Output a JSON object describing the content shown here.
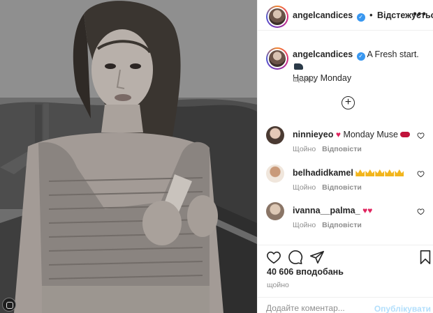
{
  "post": {
    "image_alt": "Black and white portrait of a woman holding a brush"
  },
  "header": {
    "username": "angelcandices",
    "separator": "•",
    "follow_status": "Відстежується",
    "more_label": "•••"
  },
  "caption": {
    "username": "angelcandices",
    "text": "A Fresh start.",
    "text_line2": "Happy Monday",
    "time": "Щойно"
  },
  "load_more": {
    "label": "+"
  },
  "comments": [
    {
      "username": "ninnieyeo",
      "text": "Monday Muse",
      "time": "Щойно",
      "reply": "Відповісти"
    },
    {
      "username": "belhadidkamel",
      "text": "",
      "time": "Щойно",
      "reply": "Відповісти"
    },
    {
      "username": "ivanna__palma_",
      "text": "",
      "time": "Щойно",
      "reply": "Відповісти"
    }
  ],
  "stats": {
    "likes": "40 606 вподобань",
    "time": "щойно"
  },
  "add_comment": {
    "placeholder": "Додайте коментар...",
    "publish_label": "Опублікувати"
  },
  "icons": {
    "verified": "verified-badge-icon",
    "like": "heart-icon",
    "comment": "comment-icon",
    "share": "paper-plane-icon",
    "save": "bookmark-icon",
    "more": "more-options-icon"
  },
  "colors": {
    "verified_blue": "#3897f0",
    "heart_red": "#e0245e",
    "muted_text": "#8e8e8e",
    "publish_disabled": "#b2dffc"
  }
}
